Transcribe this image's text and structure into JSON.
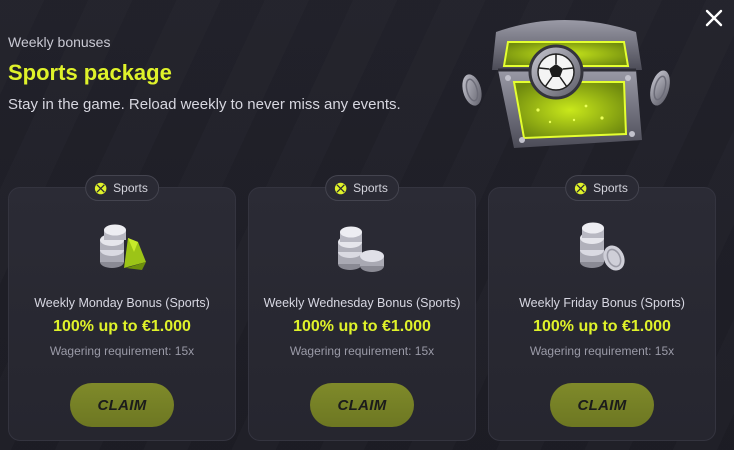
{
  "header": {
    "eyebrow": "Weekly bonuses",
    "title": "Sports package",
    "subtitle": "Stay in the game. Reload weekly to never miss any events."
  },
  "colors": {
    "accent": "#dff22a",
    "button": "#7a8526",
    "background": "#1e1e26",
    "card": "#2a2a33"
  },
  "icons": {
    "close": "close-icon",
    "hero": "treasure-chest-icon",
    "tag": "soccer-ball-icon",
    "coins": "coin-stack-icon"
  },
  "cards": [
    {
      "tag": "Sports",
      "name": "Weekly Monday Bonus (Sports)",
      "value": "100% up to €1.000",
      "wager": "Wagering requirement: 15x",
      "cta": "CLAIM"
    },
    {
      "tag": "Sports",
      "name": "Weekly Wednesday Bonus (Sports)",
      "value": "100% up to €1.000",
      "wager": "Wagering requirement: 15x",
      "cta": "CLAIM"
    },
    {
      "tag": "Sports",
      "name": "Weekly Friday Bonus (Sports)",
      "value": "100% up to €1.000",
      "wager": "Wagering requirement: 15x",
      "cta": "CLAIM"
    }
  ]
}
